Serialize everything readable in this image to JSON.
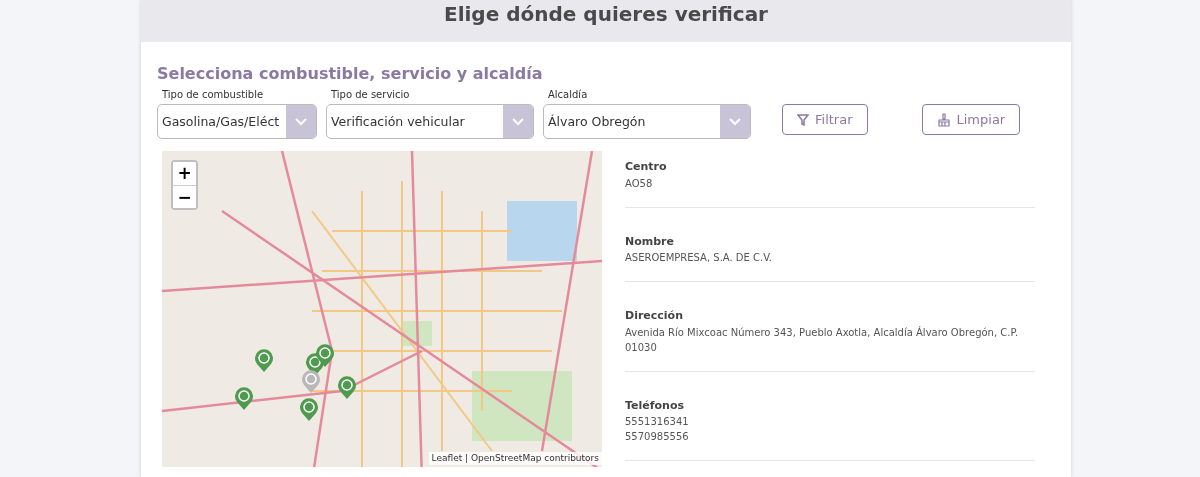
{
  "header": {
    "title": "Elige dónde quieres verificar"
  },
  "section_title": "Selecciona combustible, servicio y alcaldía",
  "filters": [
    {
      "label": "Tipo de combustible",
      "value": "Gasolina/Gas/Eléct"
    },
    {
      "label": "Tipo de servicio",
      "value": "Verificación vehicular"
    },
    {
      "label": "Alcaldía",
      "value": "Álvaro Obregón"
    }
  ],
  "buttons": [
    {
      "kind": "filter",
      "label": "Filtrar"
    },
    {
      "kind": "clear",
      "label": "Limpiar"
    }
  ],
  "map": {
    "zoom_in": "+",
    "zoom_out": "−",
    "markers": [
      {
        "selected": false
      },
      {
        "selected": false
      },
      {
        "selected": false
      },
      {
        "selected": true
      },
      {
        "selected": false
      },
      {
        "selected": false
      },
      {
        "selected": false
      }
    ],
    "attribution": {
      "link_1": "Leaflet",
      "separator": "|",
      "link_2": "OpenStreetMap",
      "text": "contributors"
    }
  },
  "details": [
    {
      "label": "Centro",
      "lines": [
        "AO58"
      ]
    },
    {
      "label": "Nombre",
      "lines": [
        "ASEROEMPRESA, S.A. DE C.V."
      ]
    },
    {
      "label": "Dirección",
      "lines": [
        "Avenida Río Mixcoac Número 343, Pueblo Axotla, Alcaldía Álvaro Obregón, C.P. 01030"
      ]
    },
    {
      "label": "Teléfonos",
      "lines": [
        "5551316341",
        "5570985556"
      ]
    }
  ]
}
